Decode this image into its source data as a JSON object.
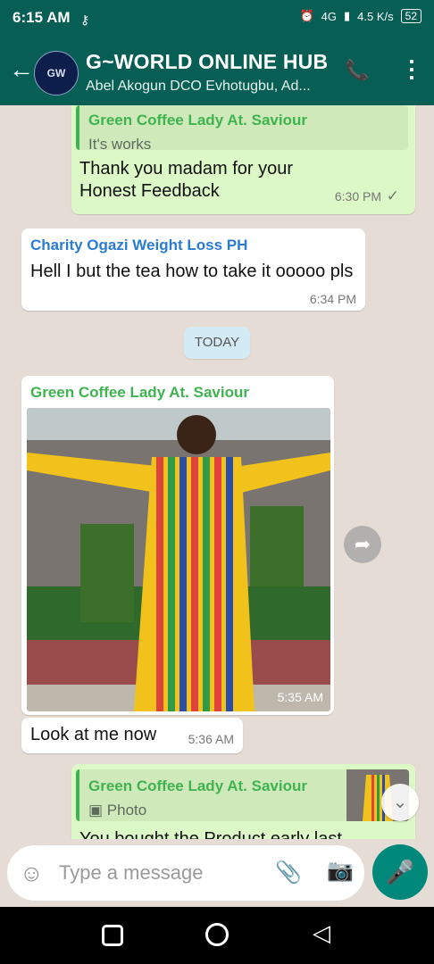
{
  "status_bar": {
    "time": "6:15 AM",
    "network_speed": "4.5 K/s",
    "battery": "52",
    "network": "4G"
  },
  "header": {
    "title": "G~WORLD ONLINE HUB",
    "subtitle": "Abel Akogun DCO Evhotugbu, Ad...",
    "avatar_text": "GW"
  },
  "messages": [
    {
      "type": "outgoing",
      "quote_name": "Green Coffee Lady At. Saviour",
      "quote_text": "It's works",
      "text": "Thank you madam for your Honest Feedback",
      "time": "6:30 PM",
      "tick": "✓"
    },
    {
      "type": "incoming",
      "sender": "Charity Ogazi Weight Loss PH",
      "sender_color": "#2a7bd4",
      "text": "Hell I but the tea how to take it ooooo pls",
      "time": "6:34 PM"
    },
    {
      "type": "date",
      "text": "TODAY"
    },
    {
      "type": "incoming_image",
      "sender": "Green Coffee Lady At. Saviour",
      "sender_color": "#3fb34f",
      "time": "5:35 AM"
    },
    {
      "type": "incoming",
      "text": "Look at me now",
      "time": "5:36 AM"
    },
    {
      "type": "outgoing",
      "quote_name": "Green Coffee Lady At. Saviour",
      "quote_text": "Photo",
      "text": "You bought the Product early last"
    }
  ],
  "input": {
    "placeholder": "Type a message"
  },
  "icons": {
    "back": "←",
    "call": "📞",
    "menu": "⋮",
    "emoji": "☺",
    "attach": "📎",
    "camera": "📷",
    "mic": "🎤",
    "forward": "➦",
    "scroll": "⌄",
    "photo_small": "▣"
  },
  "colors": {
    "header": "#075e54",
    "outgoing": "#dcf8c6",
    "mic": "#00897b"
  }
}
